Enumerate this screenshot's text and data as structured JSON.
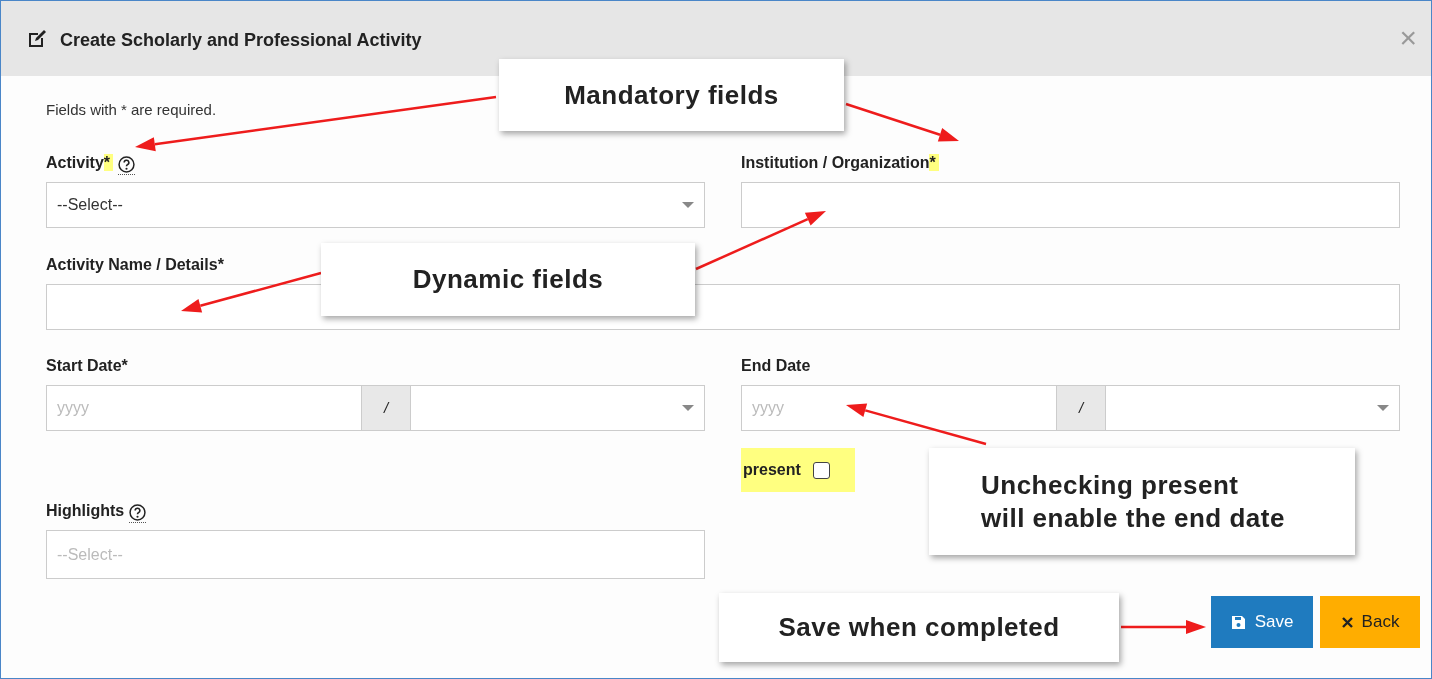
{
  "dialog": {
    "title": "Create Scholarly and Professional Activity",
    "close": "×"
  },
  "note": "Fields with * are required.",
  "fields": [
    {
      "kind": "select",
      "label": "Activity",
      "required": "*",
      "highlighted": true,
      "help": true,
      "value": "--Select--"
    },
    {
      "kind": "text",
      "label": "Institution / Organization",
      "required": "*",
      "highlighted": true,
      "help": false
    },
    {
      "kind": "text",
      "label": "Activity Name / Details",
      "required": "*",
      "highlighted": false,
      "help": false
    },
    {
      "kind": "date",
      "label": "Start Date",
      "required": "*",
      "highlighted": false,
      "help": false,
      "placeholder": "yyyy",
      "separator": "/"
    },
    {
      "kind": "date",
      "label": "End Date",
      "help": false,
      "placeholder": "yyyy",
      "separator": "/",
      "present": {
        "label": "present",
        "checked": false,
        "highlighted": true
      }
    },
    {
      "kind": "multiselect",
      "label": "Highlights",
      "help": true,
      "placeholder": "--Select--"
    }
  ],
  "buttons": [
    {
      "kind": "save",
      "label": "Save"
    },
    {
      "kind": "back",
      "label": "Back"
    }
  ],
  "callouts": [
    {
      "text": "Mandatory fields"
    },
    {
      "text": "Dynamic fields"
    },
    {
      "text": "Unchecking present\nwill enable the end date"
    },
    {
      "text": "Save when completed"
    }
  ]
}
